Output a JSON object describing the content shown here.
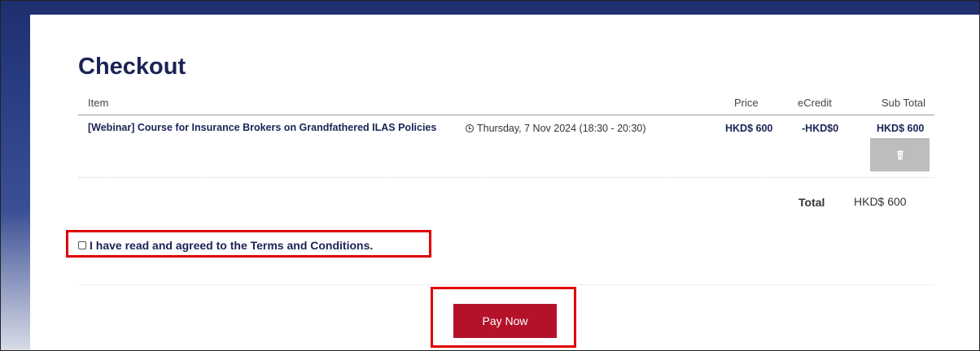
{
  "page": {
    "title": "Checkout"
  },
  "table": {
    "headers": {
      "item": "Item",
      "price": "Price",
      "ecredit": "eCredit",
      "subtotal": "Sub Total"
    },
    "rows": [
      {
        "course": "[Webinar] Course for Insurance Brokers on Grandfathered ILAS Policies",
        "datetime": "Thursday, 7 Nov 2024 (18:30 - 20:30)",
        "price": "HKD$ 600",
        "ecredit": "-HKD$0",
        "subtotal": "HKD$ 600",
        "delete_icon": "trash-icon"
      }
    ]
  },
  "summary": {
    "total_label": "Total",
    "total_value": "HKD$ 600"
  },
  "terms": {
    "label": "I have read and agreed to the Terms and Conditions.",
    "checked": false
  },
  "actions": {
    "pay_now": "Pay Now"
  },
  "colors": {
    "heading": "#1b2356",
    "pay_button": "#b4122b",
    "delete_button": "#bdbdbd",
    "highlight": "#e00000"
  }
}
